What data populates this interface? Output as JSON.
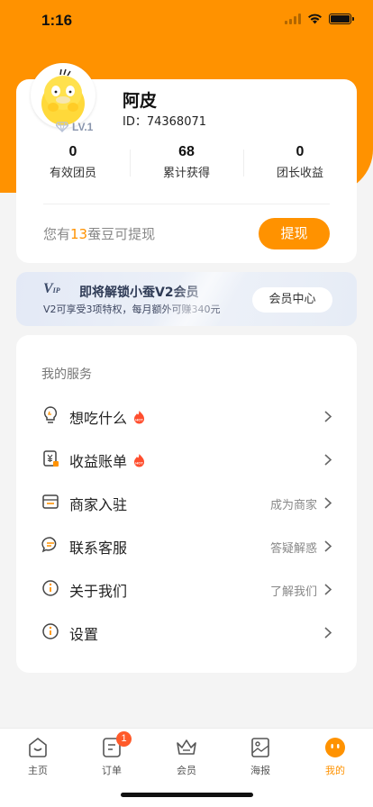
{
  "status_bar": {
    "time": "1:16"
  },
  "profile": {
    "name": "阿皮",
    "id_text": "ID：74368071",
    "level": "LV.1",
    "stats": [
      {
        "value": "0",
        "label": "有效团员"
      },
      {
        "value": "68",
        "label": "累计获得"
      },
      {
        "value": "0",
        "label": "团长收益"
      }
    ],
    "beans_prefix": "您有",
    "beans_count": "13",
    "beans_suffix": "蚕豆可提现",
    "withdraw_label": "提现"
  },
  "vip": {
    "logo": "V",
    "logo_small": "IP",
    "title": "即将解锁小蚕V2会员",
    "desc": "V2可享受3项特权，每月额外可赚340元",
    "button_label": "会员中心"
  },
  "services": {
    "title": "我的服务",
    "items": [
      {
        "label": "想吃什么",
        "hint": "",
        "hot": true,
        "icon": "lightbulb-icon"
      },
      {
        "label": "收益账单",
        "hint": "",
        "hot": true,
        "icon": "bill-icon"
      },
      {
        "label": "商家入驻",
        "hint": "成为商家",
        "hot": false,
        "icon": "store-icon"
      },
      {
        "label": "联系客服",
        "hint": "答疑解惑",
        "hot": false,
        "icon": "chat-icon"
      },
      {
        "label": "关于我们",
        "hint": "了解我们",
        "hot": false,
        "icon": "info-icon"
      },
      {
        "label": "设置",
        "hint": "",
        "hot": false,
        "icon": "settings-icon"
      }
    ]
  },
  "tabbar": {
    "tabs": [
      {
        "label": "主页",
        "icon": "home-icon"
      },
      {
        "label": "订单",
        "icon": "order-icon",
        "badge": "1"
      },
      {
        "label": "会员",
        "icon": "crown-icon"
      },
      {
        "label": "海报",
        "icon": "poster-icon"
      },
      {
        "label": "我的",
        "icon": "profile-face-icon",
        "active": true
      }
    ]
  },
  "colors": {
    "accent": "#ff9200",
    "badge": "#ff5a2a"
  }
}
